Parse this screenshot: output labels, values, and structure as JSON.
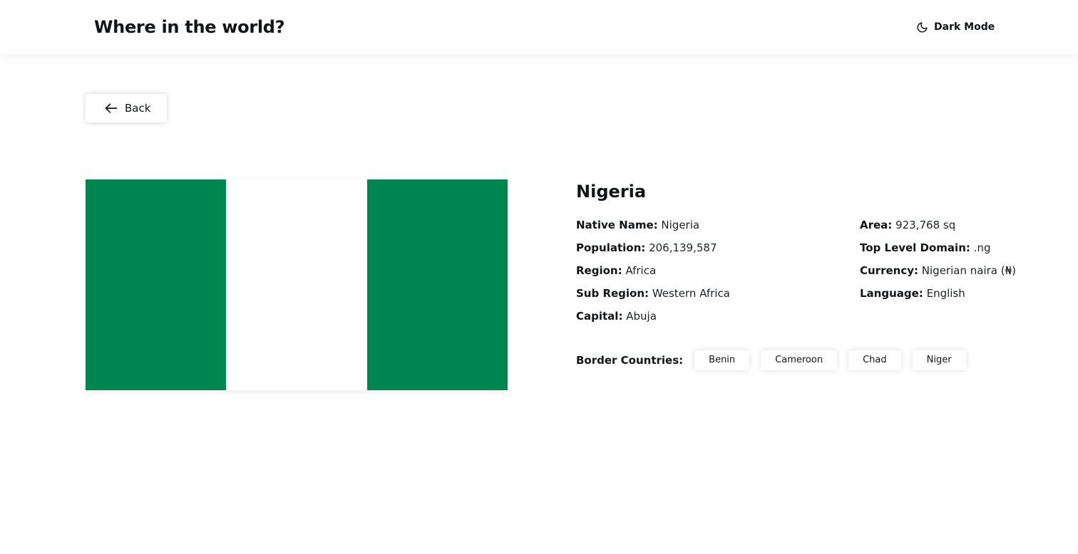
{
  "header": {
    "title": "Where in the world?",
    "mode_label": "Dark Mode",
    "mode_icon": "moon-icon"
  },
  "back": {
    "label": "Back",
    "icon": "arrow-left-icon"
  },
  "country": {
    "name": "Nigeria",
    "flag_colors": [
      "#008751",
      "#ffffff",
      "#008751"
    ],
    "left_facts": [
      {
        "label": "Native Name:",
        "value": "Nigeria"
      },
      {
        "label": "Population:",
        "value": "206,139,587"
      },
      {
        "label": "Region:",
        "value": "Africa"
      },
      {
        "label": "Sub Region:",
        "value": "Western Africa"
      },
      {
        "label": "Capital:",
        "value": "Abuja"
      }
    ],
    "right_facts": [
      {
        "label": "Area:",
        "value": "923,768 sq"
      },
      {
        "label": "Top Level Domain:",
        "value": ".ng"
      },
      {
        "label": "Currency:",
        "value": "Nigerian naira (₦)"
      },
      {
        "label": "Language:",
        "value": "English"
      }
    ],
    "borders_label": "Border Countries:",
    "borders": [
      "Benin",
      "Cameroon",
      "Chad",
      "Niger"
    ]
  }
}
